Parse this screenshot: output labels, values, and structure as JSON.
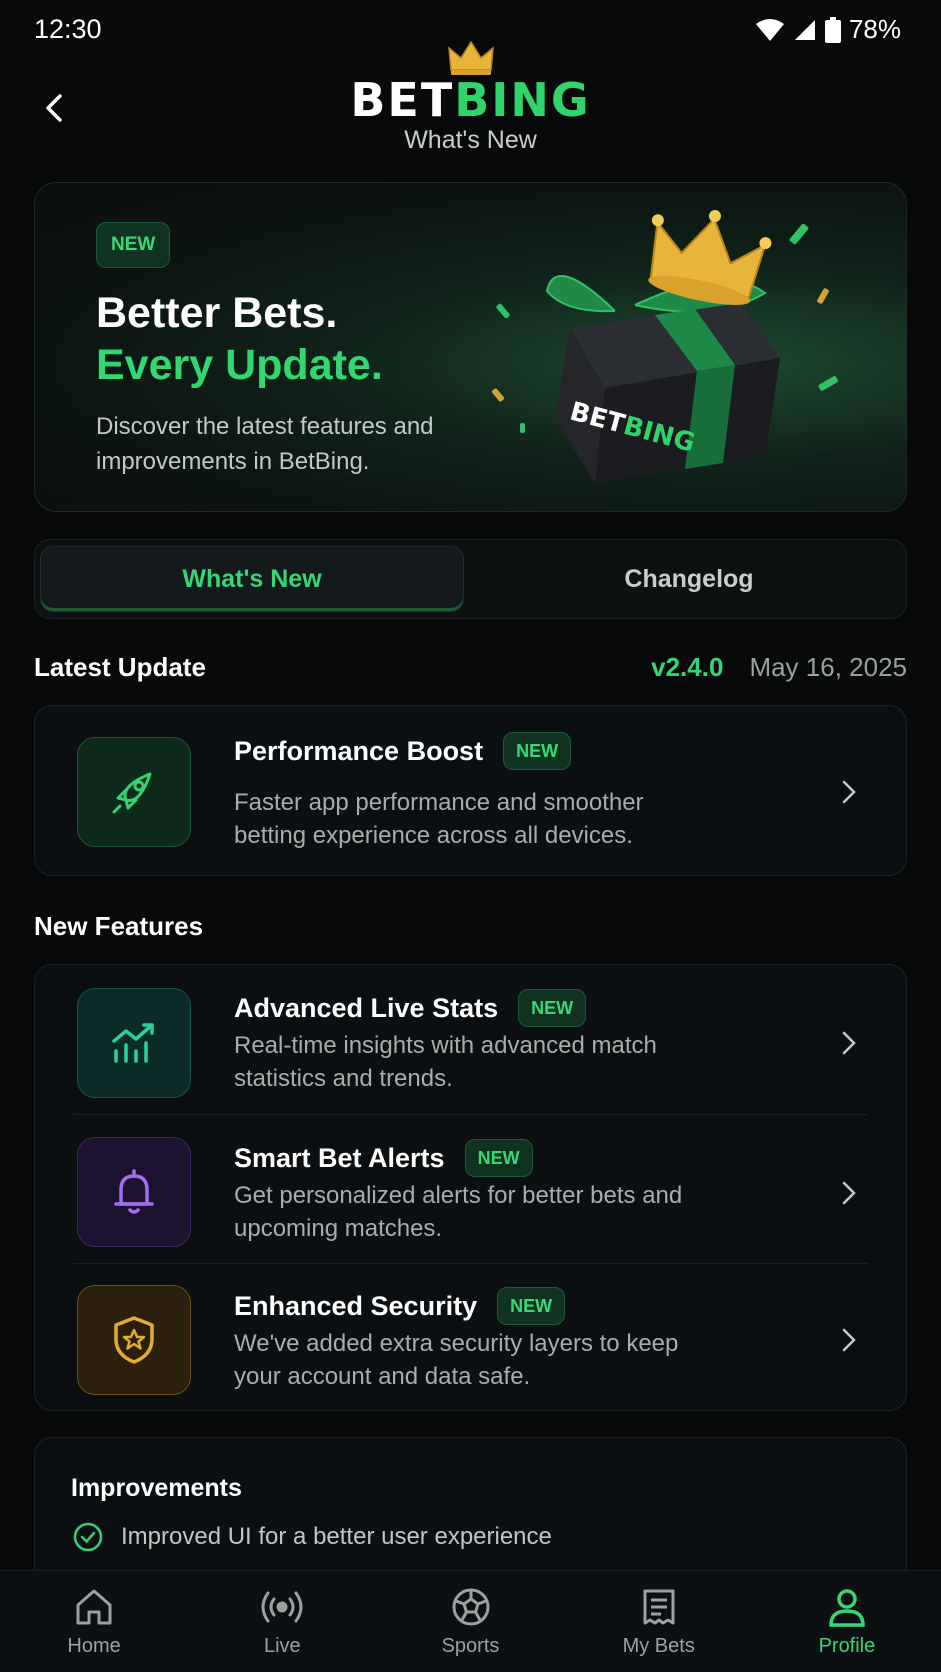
{
  "status": {
    "time": "12:30",
    "battery": "78%"
  },
  "header": {
    "logo_part1": "BET",
    "logo_part2": "BING",
    "subtitle": "What's New"
  },
  "hero": {
    "badge": "NEW",
    "line1": "Better Bets.",
    "line2": "Every Update.",
    "description": "Discover the latest features and improvements in BetBing.",
    "box_logo_part1": "BET",
    "box_logo_part2": "BING"
  },
  "tabs": [
    {
      "label": "What's New",
      "active": true
    },
    {
      "label": "Changelog",
      "active": false
    }
  ],
  "latest": {
    "section_title": "Latest Update",
    "version": "v2.4.0",
    "date": "May 16, 2025",
    "item": {
      "title": "Performance Boost",
      "badge": "NEW",
      "description": "Faster app performance and smoother betting experience across all devices.",
      "icon": "rocket-icon"
    }
  },
  "features": {
    "section_title": "New Features",
    "items": [
      {
        "title": "Advanced Live Stats",
        "badge": "NEW",
        "description": "Real-time insights with advanced match statistics and trends.",
        "icon": "chart-trend-icon"
      },
      {
        "title": "Smart Bet Alerts",
        "badge": "NEW",
        "description": "Get personalized alerts for better bets and upcoming matches.",
        "icon": "bell-icon"
      },
      {
        "title": "Enhanced Security",
        "badge": "NEW",
        "description": "We've added extra security layers to keep your account and data safe.",
        "icon": "shield-star-icon"
      }
    ]
  },
  "improvements": {
    "title": "Improvements",
    "items": [
      "Improved UI for a better user experience"
    ]
  },
  "bottom_nav": [
    {
      "label": "Home",
      "icon": "home-icon",
      "active": false
    },
    {
      "label": "Live",
      "icon": "live-broadcast-icon",
      "active": false
    },
    {
      "label": "Sports",
      "icon": "soccer-ball-icon",
      "active": false
    },
    {
      "label": "My Bets",
      "icon": "bet-slip-icon",
      "active": false
    },
    {
      "label": "Profile",
      "icon": "user-icon",
      "active": true
    }
  ],
  "colors": {
    "accent": "#36d674",
    "background": "#07090b",
    "card": "#0c0f11"
  }
}
